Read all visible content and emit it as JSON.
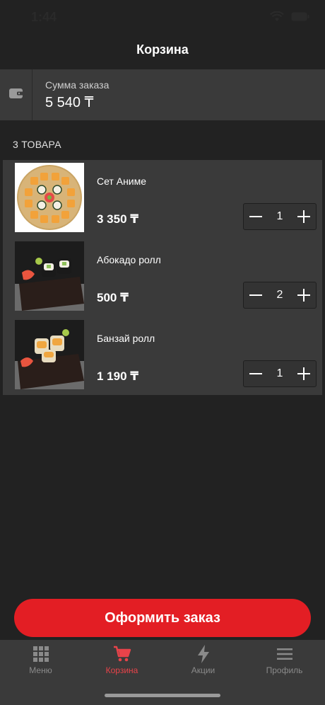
{
  "status_bar": {
    "time": "1:44"
  },
  "header": {
    "title": "Корзина"
  },
  "summary": {
    "label": "Сумма заказа",
    "value": "5 540 ₸",
    "icon": "wallet-icon"
  },
  "cart": {
    "count_label": "3 ТОВАРА",
    "items": [
      {
        "name": "Сет Аниме",
        "price": "3 350 ₸",
        "quantity": "1"
      },
      {
        "name": "Абокадо ролл",
        "price": "500 ₸",
        "quantity": "2"
      },
      {
        "name": "Банзай ролл",
        "price": "1 190 ₸",
        "quantity": "1"
      }
    ]
  },
  "checkout": {
    "button_label": "Оформить заказ"
  },
  "tab_bar": {
    "tabs": [
      {
        "label": "Меню",
        "icon": "grid-icon",
        "active": false
      },
      {
        "label": "Корзина",
        "icon": "cart-icon",
        "active": true
      },
      {
        "label": "Акции",
        "icon": "lightning-icon",
        "active": false
      },
      {
        "label": "Профиль",
        "icon": "menu-icon",
        "active": false
      }
    ]
  },
  "colors": {
    "accent": "#e31e24",
    "active_tab": "#e8434a",
    "background": "#222222",
    "panel": "#3a3a3a"
  }
}
